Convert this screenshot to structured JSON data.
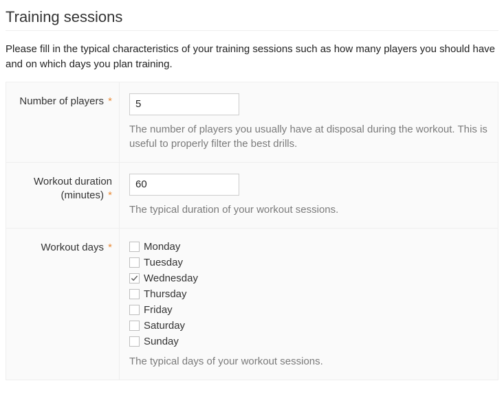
{
  "section_title": "Training sessions",
  "intro": "Please fill in the typical characteristics of your training sessions such as how many players you should have and on which days you plan training.",
  "required_mark": "*",
  "fields": {
    "players": {
      "label": "Number of players",
      "value": "5",
      "help": "The number of players you usually have at disposal during the workout. This is useful to properly filter the best drills."
    },
    "duration": {
      "label": "Workout duration (minutes)",
      "value": "60",
      "help": "The typical duration of your workout sessions."
    },
    "days": {
      "label": "Workout days",
      "help": "The typical days of your workout sessions.",
      "options": [
        {
          "label": "Monday",
          "checked": false
        },
        {
          "label": "Tuesday",
          "checked": false
        },
        {
          "label": "Wednesday",
          "checked": true
        },
        {
          "label": "Thursday",
          "checked": false
        },
        {
          "label": "Friday",
          "checked": false
        },
        {
          "label": "Saturday",
          "checked": false
        },
        {
          "label": "Sunday",
          "checked": false
        }
      ]
    }
  }
}
